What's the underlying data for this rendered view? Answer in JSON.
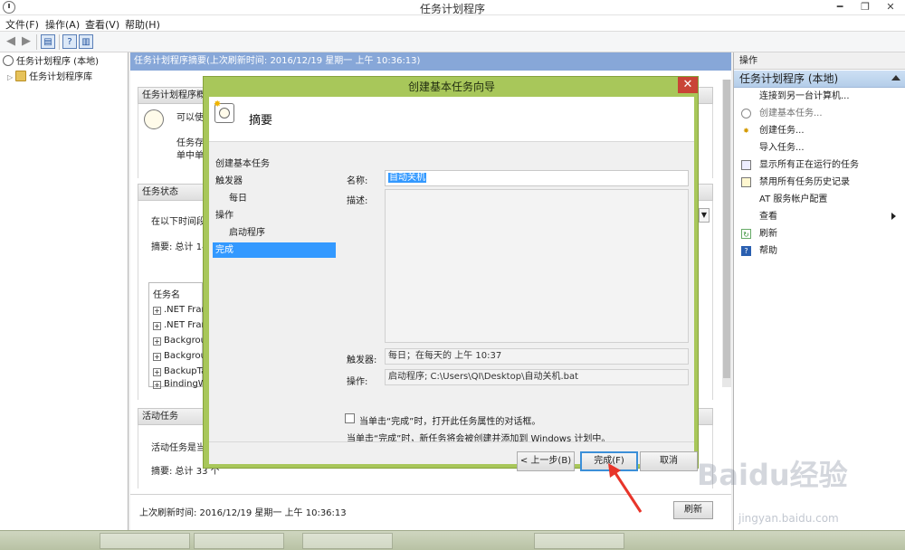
{
  "window": {
    "title": "任务计划程序",
    "min": "━",
    "max": "❐",
    "close": "✕"
  },
  "menu": [
    "文件(F)",
    "操作(A)",
    "查看(V)",
    "帮助(H)"
  ],
  "tree": {
    "root": "任务计划程序 (本地)",
    "library": "任务计划程序库"
  },
  "center": {
    "header": "任务计划程序摘要(上次刷新时间: 2016/12/19 星期一 上午 10:36:13)",
    "overview_title": "任务计划程序概",
    "overview_line1": "可以使",
    "overview_line2": "任务存",
    "overview_line3": "单中单",
    "status_title": "任务状态",
    "status_line": "在以下时间段",
    "status_summary": "摘要: 总计 14",
    "task_list_header": "任务名",
    "tasks": [
      ".NET Fran",
      ".NET Fran",
      "Backgrou",
      "Backgrou",
      "BackupTa",
      "BindingW"
    ],
    "active_title": "活动任务",
    "active_line": "活动任务是当",
    "active_summary": "摘要: 总计 33 个",
    "last_refresh": "上次刷新时间: 2016/12/19 星期一 上午 10:36:13",
    "refresh_btn": "刷新"
  },
  "actions": {
    "title": "操作",
    "group": "任务计划程序 (本地)",
    "items": [
      {
        "label": "连接到另一台计算机...",
        "icon": "",
        "dim": false
      },
      {
        "label": "创建基本任务...",
        "icon": "basic-task-icon",
        "dim": true
      },
      {
        "label": "创建任务...",
        "icon": "create-task-icon",
        "dim": false
      },
      {
        "label": "导入任务...",
        "icon": "",
        "dim": false
      },
      {
        "label": "显示所有正在运行的任务",
        "icon": "running-tasks-icon",
        "dim": false
      },
      {
        "label": "禁用所有任务历史记录",
        "icon": "history-icon",
        "dim": false
      },
      {
        "label": "AT 服务帐户配置",
        "icon": "",
        "dim": false
      },
      {
        "label": "查看",
        "icon": "",
        "dim": false
      },
      {
        "label": "刷新",
        "icon": "refresh-icon",
        "dim": false
      },
      {
        "label": "帮助",
        "icon": "help-icon",
        "dim": false
      }
    ]
  },
  "dialog": {
    "title": "创建基本任务向导",
    "close": "✕",
    "header_title": "摘要",
    "steps": [
      "创建基本任务",
      "触发器",
      "每日",
      "操作",
      "启动程序",
      "完成"
    ],
    "name_label": "名称:",
    "name_value": "自动关机",
    "desc_label": "描述:",
    "trigger_label": "触发器:",
    "trigger_value": "每日；在每天的 上午 10:37",
    "action_label": "操作:",
    "action_value": "启动程序; C:\\Users\\QI\\Desktop\\自动关机.bat",
    "checkbox_label": "当单击“完成”时，打开此任务属性的对话框。",
    "info": "当单击“完成”时，新任务将会被创建并添加到 Windows 计划中。",
    "back_btn": "< 上一步(B)",
    "finish_btn": "完成(F)",
    "cancel_btn": "取消"
  },
  "watermark": {
    "brand": "Baidu经验",
    "url": "jingyan.baidu.com"
  },
  "colors": {
    "accent": "#3399ff",
    "dialog_frame": "#a8c75a",
    "close_red": "#c94436",
    "pane_header": "#87a7d8"
  }
}
